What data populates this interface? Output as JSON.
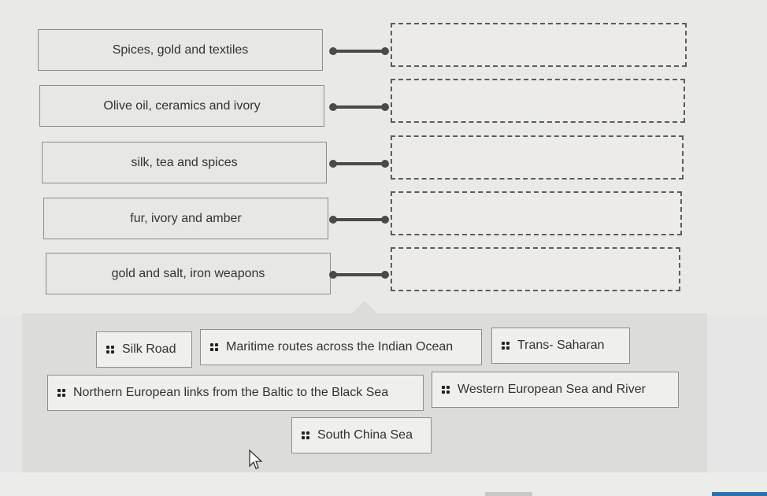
{
  "matching": {
    "prompts": [
      {
        "label": "Spices, gold and textiles",
        "answer": ""
      },
      {
        "label": "Olive oil, ceramics and ivory",
        "answer": ""
      },
      {
        "label": "silk, tea and spices",
        "answer": ""
      },
      {
        "label": "fur, ivory and amber",
        "answer": ""
      },
      {
        "label": "gold and salt, iron weapons",
        "answer": ""
      }
    ]
  },
  "answer_bank": {
    "options": [
      {
        "label": "Silk Road",
        "icon": "drag-handle-icon"
      },
      {
        "label": "Maritime routes across the Indian Ocean",
        "icon": "drag-handle-icon"
      },
      {
        "label": "Trans- Saharan",
        "icon": "drag-handle-icon"
      },
      {
        "label": "Northern European links from the Baltic to the Black Sea",
        "icon": "drag-handle-icon"
      },
      {
        "label": "Western European Sea and River",
        "icon": "drag-handle-icon"
      },
      {
        "label": "South China Sea",
        "icon": "drag-handle-icon"
      }
    ]
  },
  "colors": {
    "connector": "#4a4a4a",
    "drop_zone_border": "#5c5c5c",
    "bank_background": "#dcdcdb",
    "accent_button": "#2f6fb1"
  }
}
